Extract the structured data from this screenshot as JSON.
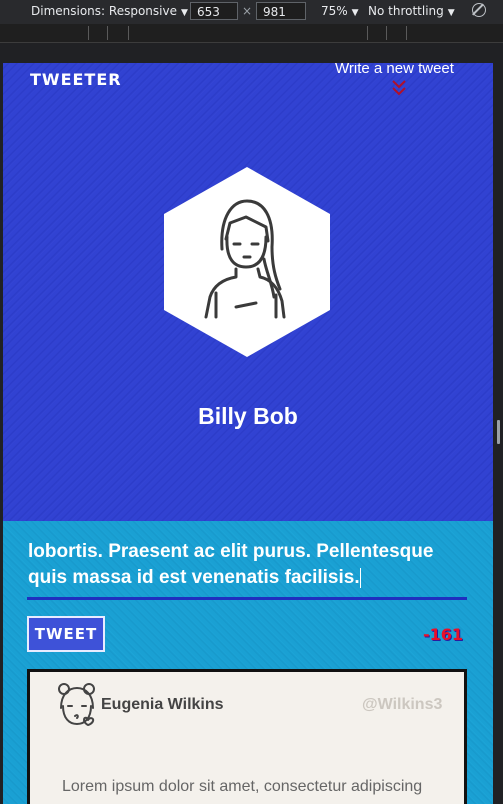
{
  "devtools": {
    "dimensions_label": "Dimensions: Responsive",
    "width_value": "653",
    "height_value": "981",
    "times": "×",
    "zoom": "75%",
    "throttling": "No throttling",
    "caret": "▼"
  },
  "header": {
    "logo": "TWEETER",
    "write_link": "Write a new tweet"
  },
  "profile": {
    "name": "Billy Bob"
  },
  "compose": {
    "text_line1": "lobortis. Praesent ac elit purus. Pellentesque",
    "text_line2": "quis massa id est venenatis facilisis.",
    "button_label": "TWEET",
    "counter": "-161"
  },
  "tweet": {
    "user_name": "Eugenia Wilkins",
    "handle": "@Wilkins3",
    "body": "Lorem ipsum dolor sit amet, consectetur adipiscing"
  },
  "colors": {
    "hero_bg": "#3142d2",
    "compose_bg": "#1aa0d3",
    "counter": "#e8102a"
  }
}
